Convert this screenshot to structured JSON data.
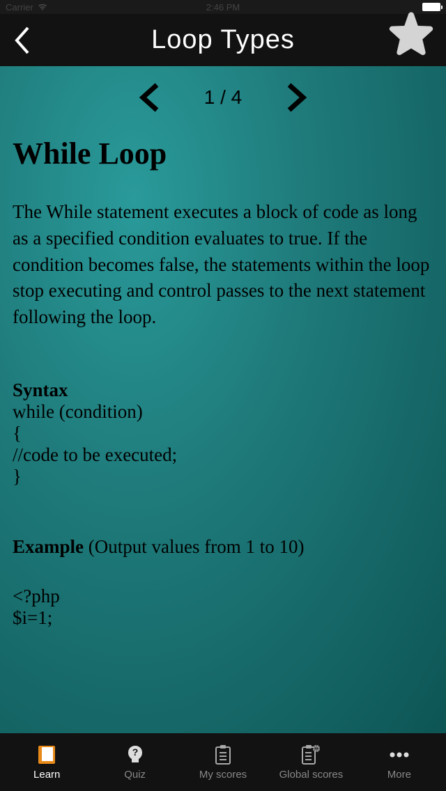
{
  "status": {
    "carrier": "Carrier",
    "time": "2:46 PM"
  },
  "header": {
    "title": "Loop Types"
  },
  "pager": {
    "current": 1,
    "total": 4,
    "label": "1 / 4"
  },
  "article": {
    "title": "While Loop",
    "body": "The While statement executes a block of code as long as a specified condition evaluates to true. If the condition becomes false, the statements within the loop stop executing and control passes to the next statement following the loop.",
    "syntax_label": "Syntax",
    "syntax_code": "while (condition)\n{\n   //code to be executed;\n}",
    "example_label": "Example",
    "example_desc": " (Output values from 1 to 10)",
    "example_code": "<?php\n$i=1;"
  },
  "tabs": {
    "learn": "Learn",
    "quiz": "Quiz",
    "myscores": "My scores",
    "globalscores": "Global scores",
    "more": "More"
  }
}
